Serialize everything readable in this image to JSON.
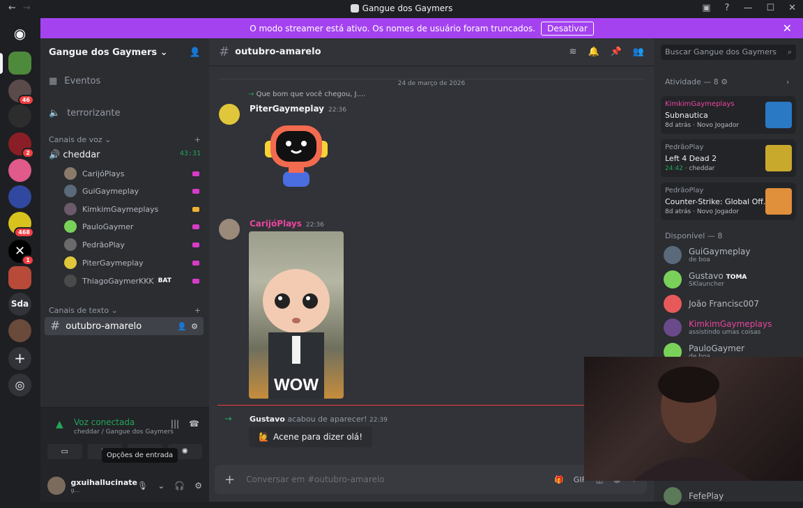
{
  "window": {
    "title": "Gangue dos Gaymers"
  },
  "banner": {
    "text": "O modo streamer está ativo. Os nomes de usuário foram truncados.",
    "button": "Desativar"
  },
  "guild_badges": [
    "46",
    "2",
    "468",
    "1"
  ],
  "guild_text": "Sda",
  "sidebar": {
    "server_name": "Gangue dos Gaymers",
    "events": "Eventos",
    "stage": "terrorizante",
    "voice_category": "Canais de voz",
    "voice_channel": "cheddar",
    "voice_timer": "43:31",
    "voice_users": [
      {
        "name": "CarijóPlays",
        "tag": ""
      },
      {
        "name": "GuiGaymeplay",
        "tag": ""
      },
      {
        "name": "KimkimGaymeplays",
        "tag": ""
      },
      {
        "name": "PauloGaymer",
        "tag": ""
      },
      {
        "name": "PedrãoPlay",
        "tag": ""
      },
      {
        "name": "PiterGaymeplay",
        "tag": ""
      },
      {
        "name": "ThiagoGaymerKKK",
        "tag": "BAT"
      }
    ],
    "text_category": "Canais de texto",
    "text_channel": "outubro-amarelo"
  },
  "voice_panel": {
    "title": "Voz conectada",
    "subtitle": "cheddar / Gangue dos Gaymers"
  },
  "tooltip": "Opções de entrada",
  "user_panel": {
    "name": "gxuihallucinate",
    "status": "g..."
  },
  "chat": {
    "channel": "outubro-amarelo",
    "date_divider": "24 de março de 2026",
    "reply_preview": "Que bom que você chegou, J....",
    "messages": [
      {
        "author": "PiterGaymeplay",
        "time": "22:36"
      },
      {
        "author": "CarijóPlays",
        "time": "22:36"
      }
    ],
    "gif_text": "WOW",
    "join": {
      "name": "Gustavo",
      "text": "acabou de aparecer!",
      "time": "22:39"
    },
    "wave_button": "Acene para dizer olá!",
    "composer_placeholder": "Conversar em #outubro-amarelo"
  },
  "members": {
    "search_placeholder": "Buscar Gangue dos Gaymers",
    "activity_header": "Atividade — 8",
    "activities": [
      {
        "user": "KimkimGaymeplays",
        "game": "Subnautica",
        "meta": "8d atrás",
        "extra": "Novo Jogador"
      },
      {
        "user": "PedrãoPlay",
        "game": "Left 4 Dead 2",
        "meta": "24:42",
        "extra": "cheddar"
      },
      {
        "user": "PedrãoPlay",
        "game": "Counter-Strike: Global Off...",
        "meta": "8d atrás",
        "extra": "Novo Jogador"
      }
    ],
    "available_header": "Disponível — 8",
    "list": [
      {
        "name": "GuiGaymeplay",
        "status": "de boa",
        "tag": ""
      },
      {
        "name": "Gustavo",
        "status": "SKlauncher",
        "tag": "TOMA"
      },
      {
        "name": "João Francisc007",
        "status": "",
        "tag": ""
      },
      {
        "name": "KimkimGaymeplays",
        "status": "assistindo umas coisas",
        "tag": ""
      },
      {
        "name": "PauloGaymer",
        "status": "de boa",
        "tag": ""
      },
      {
        "name": "FefePlay",
        "status": "",
        "tag": ""
      }
    ]
  },
  "colors": {
    "accent": "#a442f0",
    "online": "#23a55a",
    "highlight_name": "#eb459e"
  }
}
